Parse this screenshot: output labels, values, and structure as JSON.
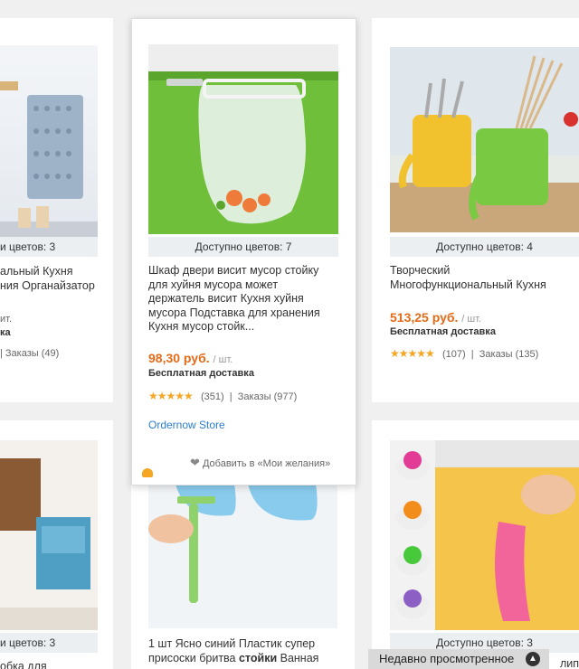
{
  "products": {
    "left_top": {
      "colors": "и цветов: 3",
      "title_line1": "альный Кухня",
      "title_line2": "ния Органайзатор",
      "price_tail": "ит.",
      "ship_tail": "ка",
      "rating": "|  Заказы (49)"
    },
    "popup": {
      "colors": "Доступно цветов: 7",
      "title": "Шкаф двери висит мусор стойку для хуйня мусора может держатель висит Кухня хуйня мусора Подставка для хранения Кухня мусор стойк...",
      "price": "98,30 руб.",
      "unit": "/ шт.",
      "shipping": "Бесплатная доставка",
      "rating_count": "(351)",
      "orders": "Заказы (977)",
      "store": "Ordernow Store",
      "wishlist": "Добавить в «Мои желания»"
    },
    "right_top": {
      "colors": "Доступно цветов: 4",
      "title_line1": "Творческий",
      "title_line2": "Многофункциональный Кухня",
      "price": "513,25 руб.",
      "unit": "/ шт.",
      "shipping": "Бесплатная доставка",
      "rating_count": "(107)",
      "orders": "Заказы (135)"
    },
    "left_bottom": {
      "colors": "и цветов: 3",
      "title": "обка для"
    },
    "middle_bottom": {
      "title_line1": "1 шт Ясно синий Пластик супер",
      "title_line2a": "присоски бритва ",
      "title_line2b": "стойки",
      "title_line2c": " Ванная"
    },
    "right_bottom": {
      "colors": "Доступно цветов: 3",
      "side_tail": "лип"
    }
  },
  "recent": {
    "label": "Недавно просмотренное"
  },
  "stars": "★★★★★",
  "colors": {
    "accent": "#e56a17",
    "link": "#2d7dd2",
    "star": "#f5a623"
  }
}
